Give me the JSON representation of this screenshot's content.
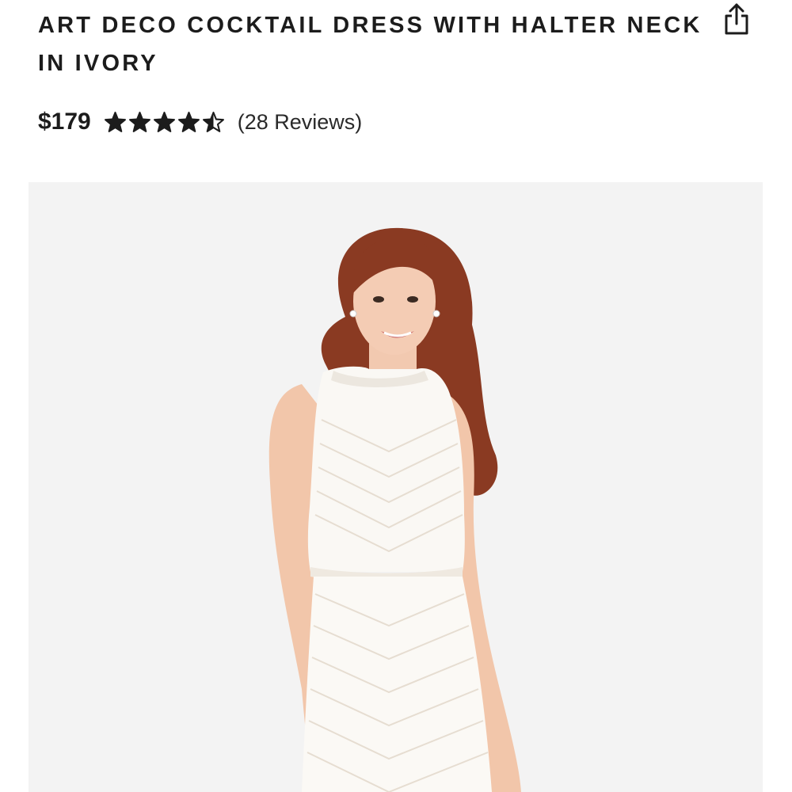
{
  "product": {
    "title": "ART DECO COCKTAIL DRESS WITH HALTER NECK IN IVORY",
    "price": "$179",
    "rating": 4.5,
    "rating_max": 5,
    "reviews_label": "(28 Reviews)"
  },
  "icons": {
    "share": "share-icon",
    "star": "star-icon"
  },
  "colors": {
    "text": "#1c1c1c",
    "image_bg": "#f3f3f3",
    "dress": "#faf8f4",
    "hair": "#8a3a22"
  }
}
